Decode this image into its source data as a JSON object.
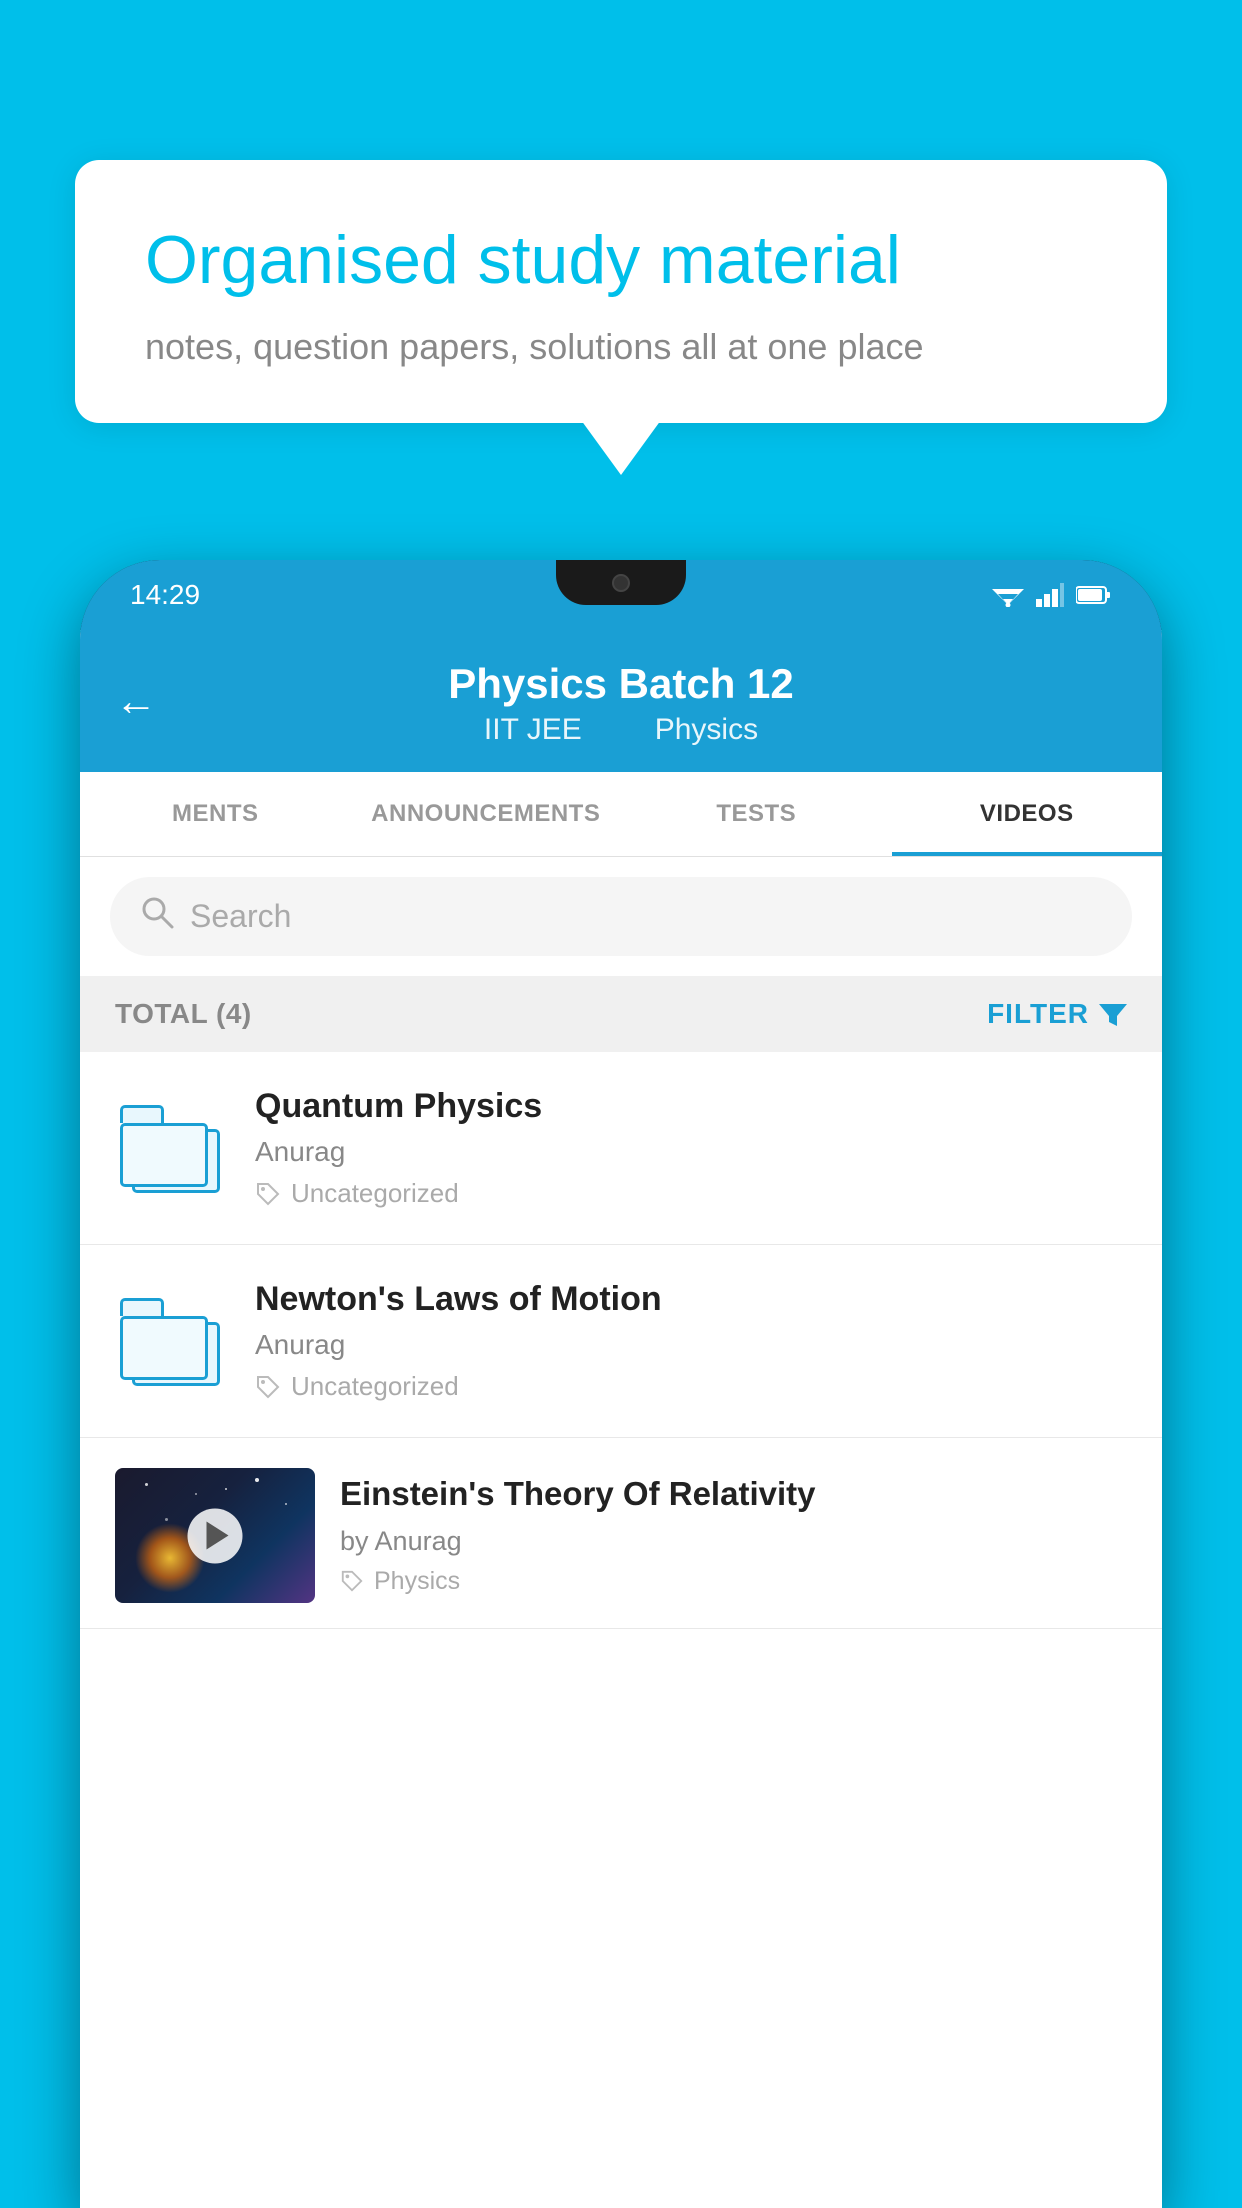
{
  "background": {
    "color": "#00BFEA"
  },
  "speech_bubble": {
    "title": "Organised study material",
    "subtitle": "notes, question papers, solutions all at one place"
  },
  "phone": {
    "status_bar": {
      "time": "14:29",
      "icons": [
        "wifi",
        "signal",
        "battery"
      ]
    },
    "header": {
      "title": "Physics Batch 12",
      "subtitle_part1": "IIT JEE",
      "subtitle_part2": "Physics",
      "back_arrow": "←"
    },
    "tabs": [
      {
        "label": "MENTS",
        "active": false
      },
      {
        "label": "ANNOUNCEMENTS",
        "active": false
      },
      {
        "label": "TESTS",
        "active": false
      },
      {
        "label": "VIDEOS",
        "active": true
      }
    ],
    "search": {
      "placeholder": "Search"
    },
    "filter_bar": {
      "total_label": "TOTAL (4)",
      "filter_label": "FILTER"
    },
    "videos": [
      {
        "id": 1,
        "title": "Quantum Physics",
        "author": "Anurag",
        "tag": "Uncategorized",
        "type": "folder"
      },
      {
        "id": 2,
        "title": "Newton's Laws of Motion",
        "author": "Anurag",
        "tag": "Uncategorized",
        "type": "folder"
      },
      {
        "id": 3,
        "title": "Einstein's Theory Of Relativity",
        "author_prefix": "by",
        "author": "Anurag",
        "tag": "Physics",
        "type": "video"
      }
    ]
  }
}
